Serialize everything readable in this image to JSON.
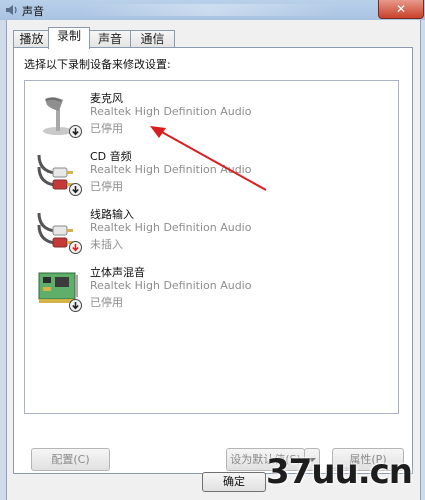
{
  "window": {
    "title": "声音",
    "close_glyph": "✕"
  },
  "tabs": [
    {
      "label": "播放",
      "active": false
    },
    {
      "label": "录制",
      "active": true
    },
    {
      "label": "声音",
      "active": false
    },
    {
      "label": "通信",
      "active": false
    }
  ],
  "instruction": "选择以下录制设备来修改设置:",
  "devices": [
    {
      "name": "麦克风",
      "driver": "Realtek High Definition Audio",
      "status": "已停用",
      "icon": "microphone-icon",
      "status_icon": "disabled-down-arrow-icon"
    },
    {
      "name": "CD 音频",
      "driver": "Realtek High Definition Audio",
      "status": "已停用",
      "icon": "rca-cable-icon",
      "status_icon": "disabled-down-arrow-icon"
    },
    {
      "name": "线路输入",
      "driver": "Realtek High Definition Audio",
      "status": "未插入",
      "icon": "rca-cable-icon",
      "status_icon": "unplugged-red-arrow-icon"
    },
    {
      "name": "立体声混音",
      "driver": "Realtek High Definition Audio",
      "status": "已停用",
      "icon": "sound-card-icon",
      "status_icon": "disabled-down-arrow-icon"
    }
  ],
  "buttons": {
    "configure": "配置(C)",
    "set_default": "设为默认值(S)",
    "properties": "属性(P)",
    "ok": "确定"
  },
  "annotation": {
    "color": "#d81e1e"
  },
  "watermark": {
    "text": "37uu.cn"
  }
}
